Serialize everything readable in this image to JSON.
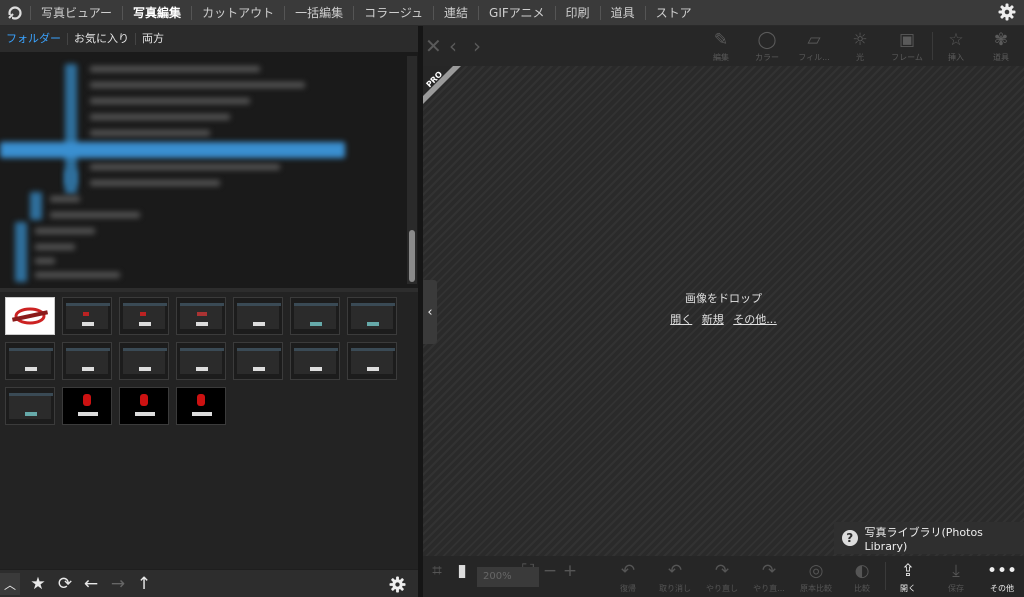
{
  "menubar": {
    "items": [
      "写真ビュアー",
      "写真編集",
      "カットアウト",
      "一括編集",
      "コラージュ",
      "連結",
      "GIFアニメ",
      "印刷",
      "道具",
      "ストア"
    ],
    "active_index": 1
  },
  "subtabs": {
    "folder": "フォルダー",
    "favorites": "お気に入り",
    "both": "両方"
  },
  "toolbar": {
    "edit": "編集",
    "color": "カラー",
    "filter": "フィル...",
    "light": "光",
    "frame": "フレーム",
    "insert": "挿入",
    "tools": "道具"
  },
  "pro_badge": "PRO",
  "canvas": {
    "drop_text": "画像をドロップ",
    "open_link": "開く",
    "new_link": "新規",
    "other_link": "その他..."
  },
  "photos_library": {
    "label": "写真ライブラリ(Photos Library)",
    "help": "?"
  },
  "bottom": {
    "zoom": "200%",
    "restore": "復帰",
    "undo": "取り消し",
    "redo": "やり直し",
    "redo_more": "やり直...",
    "compare_orig": "原本比較",
    "compare": "比較",
    "open": "開く",
    "save": "保存",
    "more": "その他"
  },
  "colors": {
    "accent": "#3aa3ff",
    "background": "#1e1e1e"
  },
  "icons": [
    "app-logo-icon",
    "gear-icon",
    "close-icon",
    "chevron-left-icon",
    "chevron-right-icon",
    "pencil-icon",
    "circle-icon",
    "filter-icon",
    "sun-icon",
    "frame-icon",
    "star-icon",
    "palette-icon",
    "share-icon",
    "download-icon",
    "more-icon",
    "star-icon",
    "sync-icon",
    "arrow-left-icon",
    "arrow-right-icon",
    "arrow-up-icon",
    "chevron-up-icon"
  ]
}
